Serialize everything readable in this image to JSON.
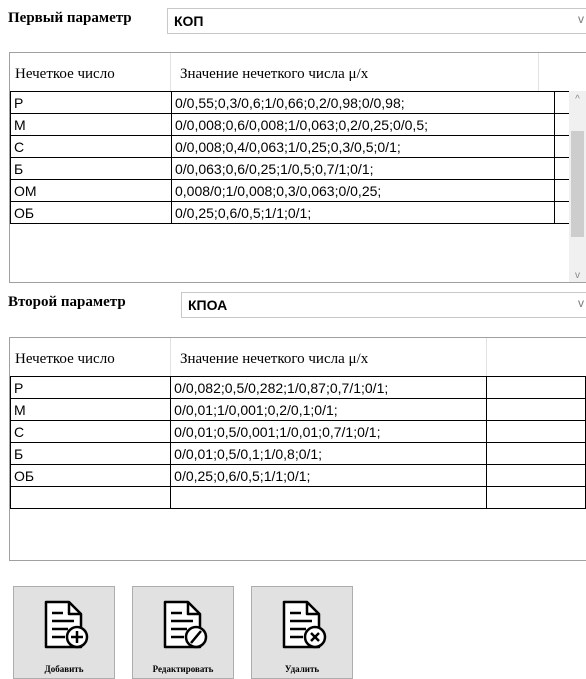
{
  "param1": {
    "label": "Первый параметр",
    "value": "КОП",
    "columns": [
      "Нечеткое число",
      "Значение нечеткого числа μ/x"
    ],
    "rows": [
      [
        "Р",
        "0/0,55;0,3/0,6;1/0,66;0,2/0,98;0/0,98;"
      ],
      [
        "М",
        "0/0,008;0,6/0,008;1/0,063;0,2/0,25;0/0,5;"
      ],
      [
        "С",
        "0/0,008;0,4/0,063;1/0,25;0,3/0,5;0/1;"
      ],
      [
        "Б",
        "0/0,063;0,6/0,25;1/0,5;0,7/1;0/1;"
      ],
      [
        "ОМ",
        "0,008/0;1/0,008;0,3/0,063;0/0,25;"
      ],
      [
        "ОБ",
        "0/0,25;0,6/0,5;1/1;0/1;"
      ]
    ],
    "scroll_arrow_up": "^",
    "scroll_arrow_down": "v"
  },
  "param2": {
    "label": "Второй параметр",
    "value": "КПОА",
    "columns": [
      "Нечеткое число",
      "Значение нечеткого числа μ/x"
    ],
    "rows": [
      [
        "Р",
        "0/0,082;0,5/0,282;1/0,87;0,7/1;0/1;"
      ],
      [
        "М",
        "0/0,01;1/0,001;0,2/0,1;0/1;"
      ],
      [
        "С",
        "0/0,01;0,5/0,001;1/0,01;0,7/1;0/1;"
      ],
      [
        "Б",
        "0/0,01;0,5/0,1;1/0,8;0/1;"
      ],
      [
        "ОБ",
        "0/0,25;0,6/0,5;1/1;0/1;"
      ],
      [
        "",
        ""
      ]
    ]
  },
  "combo_arrow": "v",
  "buttons": {
    "add": "Добавить",
    "edit": "Редактировать",
    "delete": "Удалить"
  },
  "icons": {
    "add": "document-add-icon",
    "edit": "document-edit-icon",
    "delete": "document-delete-icon"
  }
}
